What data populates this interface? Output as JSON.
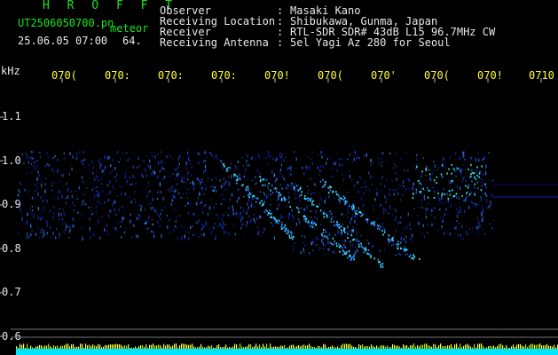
{
  "header": {
    "brand": "H R O F F T",
    "filename": "UT2506050700.pn",
    "mode": "meteor",
    "datetime": "25.06.05 07:00",
    "count": "64."
  },
  "station": [
    {
      "label": "Observer",
      "sep": ":",
      "value": "Masaki Kano"
    },
    {
      "label": "Receiving Location",
      "sep": ":",
      "value": "Shibukawa, Gunma, Japan"
    },
    {
      "label": "Receiver",
      "sep": ":",
      "value": "RTL-SDR SDR# 43dB L15 96.7MHz CW"
    },
    {
      "label": "Receiving Antenna",
      "sep": ":",
      "value": "5el Yagi Az 280 for Seoul"
    }
  ],
  "axis": {
    "y_unit": "kHz",
    "y_ticks": [
      "1.1",
      "1.0",
      "0.9",
      "0.8",
      "0.7",
      "0.6"
    ],
    "x_ticks": [
      "070(",
      "070:",
      "070:",
      "070:",
      "070!",
      "070(",
      "070'",
      "070(",
      "070!",
      "0710"
    ]
  },
  "colors": {
    "background": "#000000",
    "header_text": "#19e619",
    "label_text": "#e8e8e8",
    "time_ticks": "#ffff33",
    "signal_low": "#0a1aa0",
    "signal_high": "#3cf0ff",
    "baseline": "#00e5ff"
  }
}
